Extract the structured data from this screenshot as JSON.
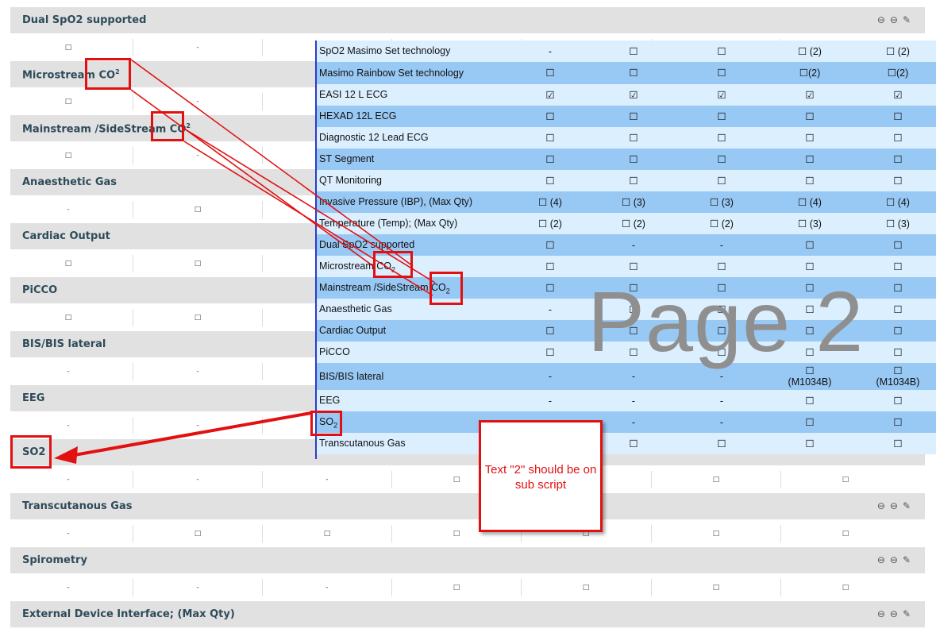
{
  "background": {
    "headers": [
      {
        "label": "Dual SpO2 supported",
        "icons": true
      },
      {
        "label": "Microstream CO",
        "sup": "2",
        "icons": false
      },
      {
        "label": "Mainstream /SideStream CO",
        "sup": "2",
        "icons": false
      },
      {
        "label": "Anaesthetic Gas",
        "icons": false
      },
      {
        "label": "Cardiac Output",
        "icons": false
      },
      {
        "label": "PiCCO",
        "icons": false
      },
      {
        "label": "BIS/BIS lateral",
        "icons": false
      },
      {
        "label": "EEG",
        "icons": false
      },
      {
        "label": "SO2",
        "icons": false
      },
      {
        "label": "Transcutanous Gas",
        "icons": true
      },
      {
        "label": "Spirometry",
        "icons": true
      },
      {
        "label": "External Device Interface; (Max Qty)",
        "icons": true
      }
    ],
    "value_rows": [
      [
        "□",
        "-",
        "",
        "",
        "",
        "",
        ""
      ],
      [
        "□",
        "-",
        "",
        "",
        "",
        "",
        ""
      ],
      [
        "□",
        "-",
        "",
        "",
        "",
        "",
        ""
      ],
      [
        "-",
        "□",
        "",
        "",
        "",
        "",
        ""
      ],
      [
        "□",
        "□",
        "",
        "",
        "",
        "",
        ""
      ],
      [
        "□",
        "□",
        "",
        "",
        "",
        "",
        ""
      ],
      [
        "-",
        "-",
        "",
        "",
        "",
        "",
        ""
      ],
      [
        "-",
        "-",
        "",
        "",
        "",
        "",
        ""
      ],
      [
        "-",
        "-",
        "-",
        "□",
        "",
        "□",
        "□"
      ],
      [
        "-",
        "□",
        "□",
        "□",
        "□",
        "□",
        "□"
      ],
      [
        "-",
        "-",
        "-",
        "□",
        "□",
        "□",
        "□"
      ]
    ],
    "icon_names": [
      "minus-circle-icon",
      "minus-circle-icon",
      "edit-icon"
    ],
    "icon_glyphs": "⊖⊖✎"
  },
  "overlay": {
    "rows": [
      {
        "label": "SpO2 Masimo Set technology",
        "values": [
          "-",
          "☐",
          "☐",
          "☐ (2)",
          "☐ (2)"
        ]
      },
      {
        "label": "Masimo Rainbow Set technology",
        "values": [
          "☐",
          "☐",
          "☐",
          "☐(2)",
          "☐(2)"
        ]
      },
      {
        "label": "EASI 12 L ECG",
        "values": [
          "☑",
          "☑",
          "☑",
          "☑",
          "☑"
        ]
      },
      {
        "label": "HEXAD 12L ECG",
        "values": [
          "☐",
          "☐",
          "☐",
          "☐",
          "☐"
        ]
      },
      {
        "label": "Diagnostic 12 Lead ECG",
        "values": [
          "☐",
          "☐",
          "☐",
          "☐",
          "☐"
        ]
      },
      {
        "label": "ST Segment",
        "values": [
          "☐",
          "☐",
          "☐",
          "☐",
          "☐"
        ]
      },
      {
        "label": "QT Monitoring",
        "values": [
          "☐",
          "☐",
          "☐",
          "☐",
          "☐"
        ]
      },
      {
        "label": "Invasive Pressure (IBP), (Max Qty)",
        "values": [
          "☐ (4)",
          "☐ (3)",
          "☐ (3)",
          "☐ (4)",
          "☐ (4)"
        ]
      },
      {
        "label": "Temperature (Temp); (Max Qty)",
        "values": [
          "☐ (2)",
          "☐ (2)",
          "☐ (2)",
          "☐ (3)",
          "☐ (3)"
        ]
      },
      {
        "label": "Dual SpO2 supported",
        "values": [
          "☐",
          "-",
          "-",
          "☐",
          "☐"
        ]
      },
      {
        "label": "Microstream CO",
        "sub": "2",
        "values": [
          "☐",
          "☐",
          "☐",
          "☐",
          "☐"
        ]
      },
      {
        "label": "Mainstream /SideStream CO",
        "sub": "2",
        "values": [
          "☐",
          "☐",
          "☐",
          "☐",
          "☐"
        ]
      },
      {
        "label": "Anaesthetic Gas",
        "values": [
          "-",
          "☐",
          "☐",
          "☐",
          "☐"
        ]
      },
      {
        "label": "Cardiac Output",
        "values": [
          "☐",
          "☐",
          "☐",
          "☐",
          "☐"
        ]
      },
      {
        "label": "PiCCO",
        "values": [
          "☐",
          "☐",
          "☐",
          "☐",
          "☐"
        ]
      },
      {
        "label": "BIS/BIS lateral",
        "values": [
          "-",
          "-",
          "-",
          "☐\n(M1034B)",
          "☐\n(M1034B)"
        ]
      },
      {
        "label": "EEG",
        "values": [
          "-",
          "-",
          "-",
          "☐",
          "☐"
        ]
      },
      {
        "label": "SO",
        "sub": "2",
        "values": [
          "",
          "-",
          "-",
          "☐",
          "☐"
        ]
      },
      {
        "label": "Transcutanous Gas",
        "values": [
          "",
          "☐",
          "☐",
          "☐",
          "☐"
        ]
      }
    ],
    "watermark": "Page 2"
  },
  "annotation": {
    "note": "Text \"2\"  should be on sub script"
  }
}
